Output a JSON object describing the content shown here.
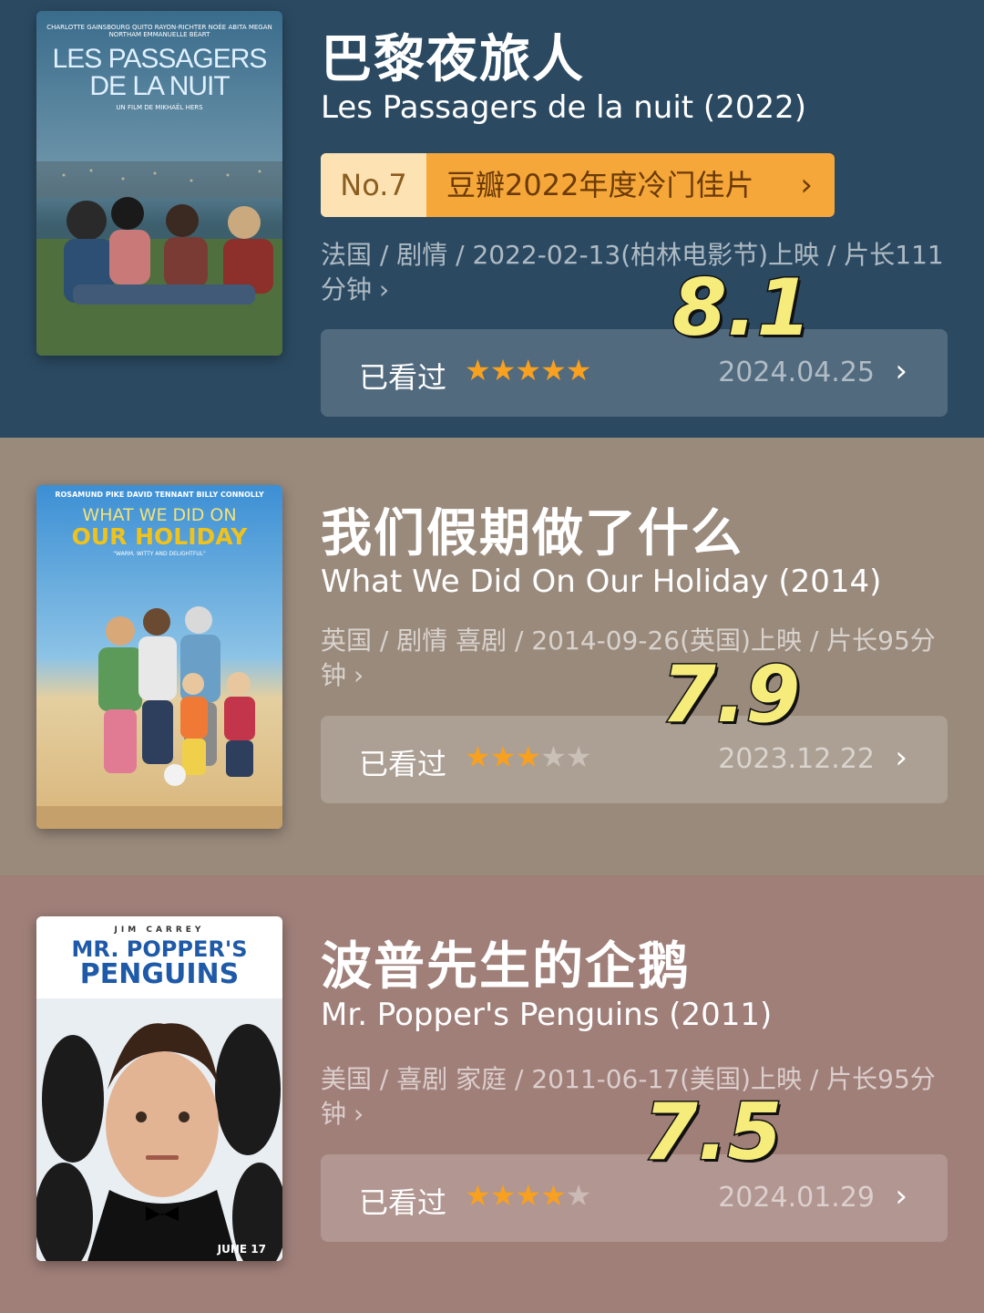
{
  "movies": [
    {
      "title_cn": "巴黎夜旅人",
      "title_en": "Les Passagers de la nuit (2022)",
      "rank_no": "No.7",
      "rank_text": "豆瓣2022年度冷门佳片",
      "meta": "法国 / 剧情 / 2022-02-13(柏林电影节)上映 / 片长111分钟",
      "meta_arrow": "›",
      "watched_label": "已看过",
      "stars_filled": 5,
      "date": "2024.04.25",
      "score": "8.1",
      "poster": {
        "credits": "CHARLOTTE GAINSBOURG   QUITO RAYON-RICHTER   NOÉE ABITA   MEGAN NORTHAM   EMMANUELLE BÉART",
        "title_line1": "LES PASSAGERS",
        "title_line2": "DE LA NUIT",
        "subtitle": "UN FILM DE MIKHAËL HERS"
      }
    },
    {
      "title_cn": "我们假期做了什么",
      "title_en": "What We Did On Our Holiday (2014)",
      "meta": "英国 / 剧情 喜剧 / 2014-09-26(英国)上映 / 片长95分钟",
      "meta_arrow": "›",
      "watched_label": "已看过",
      "stars_filled": 3,
      "date": "2023.12.22",
      "score": "7.9",
      "poster": {
        "credits": "ROSAMUND PIKE   DAVID TENNANT   BILLY CONNOLLY",
        "title_line1": "WHAT WE DID ON",
        "title_line2": "OUR HOLIDAY",
        "subtitle": "\"WARM, WITTY AND DELIGHTFUL\""
      }
    },
    {
      "title_cn": "波普先生的企鹅",
      "title_en": "Mr. Popper's Penguins (2011)",
      "meta": "美国 / 喜剧 家庭 / 2011-06-17(美国)上映 / 片长95分钟",
      "meta_arrow": "›",
      "watched_label": "已看过",
      "stars_filled": 4,
      "date": "2024.01.29",
      "score": "7.5",
      "poster": {
        "credits": "JIM CARREY",
        "title_line1": "MR. POPPER'S",
        "title_line2": "PENGUINS",
        "subtitle": "JUNE 17"
      }
    }
  ],
  "colors": {
    "section1_bg": "#2b4a62",
    "section2_bg": "#9a8a7c",
    "section3_bg": "#a07f79",
    "star_on": "#f8a020",
    "rank_bg": "#f6a73a",
    "score_fill": "#f6ec7c"
  },
  "icons": {
    "watched_arrow": "›",
    "rank_arrow": "›",
    "star": "★"
  }
}
